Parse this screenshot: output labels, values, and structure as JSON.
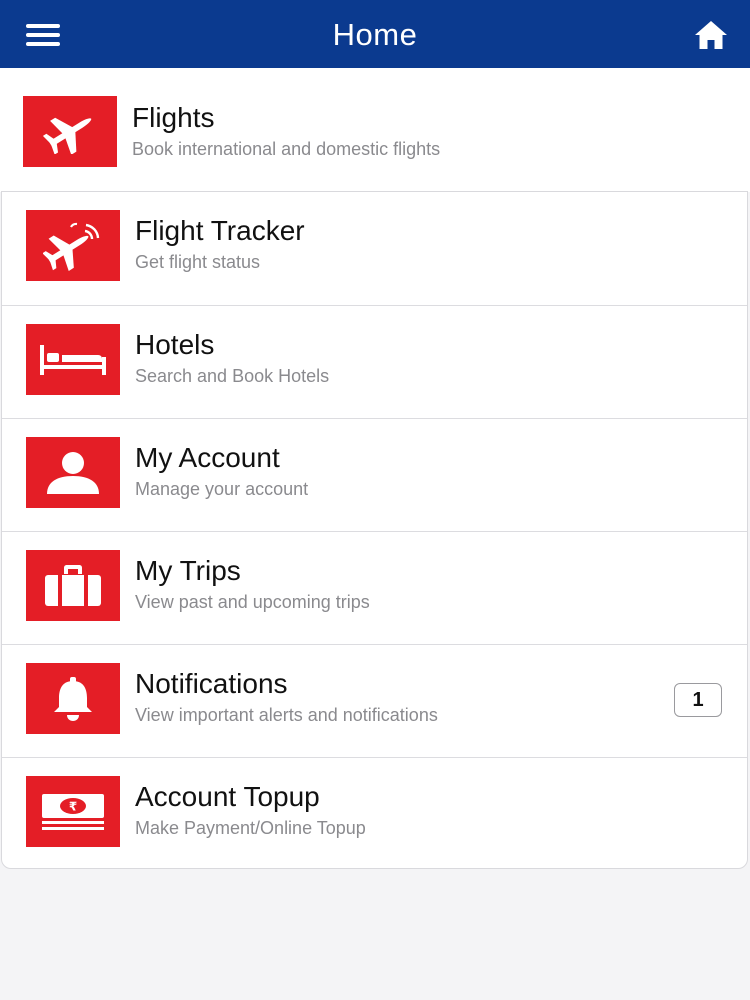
{
  "header": {
    "title": "Home"
  },
  "colors": {
    "header_bg": "#0b3a8f",
    "tile_bg": "#e41e26",
    "page_bg": "#f4f4f6",
    "title_text": "#111111",
    "subtitle_text": "#8a8a8e"
  },
  "icons": {
    "menu": "hamburger-menu-icon",
    "home": "home-icon"
  },
  "featured": {
    "title": "Flights",
    "subtitle": "Book international and domestic flights",
    "icon": "airplane-icon"
  },
  "items": [
    {
      "title": "Flight Tracker",
      "subtitle": "Get flight status",
      "icon": "flight-tracker-icon"
    },
    {
      "title": "Hotels",
      "subtitle": "Search and Book Hotels",
      "icon": "bed-icon"
    },
    {
      "title": "My Account",
      "subtitle": "Manage your account",
      "icon": "user-icon"
    },
    {
      "title": "My Trips",
      "subtitle": "View past and upcoming trips",
      "icon": "suitcase-icon"
    },
    {
      "title": "Notifications",
      "subtitle": "View important alerts and notifications",
      "icon": "bell-icon",
      "badge": "1"
    },
    {
      "title": "Account Topup",
      "subtitle": "Make Payment/Online Topup",
      "icon": "money-stack-icon"
    }
  ]
}
